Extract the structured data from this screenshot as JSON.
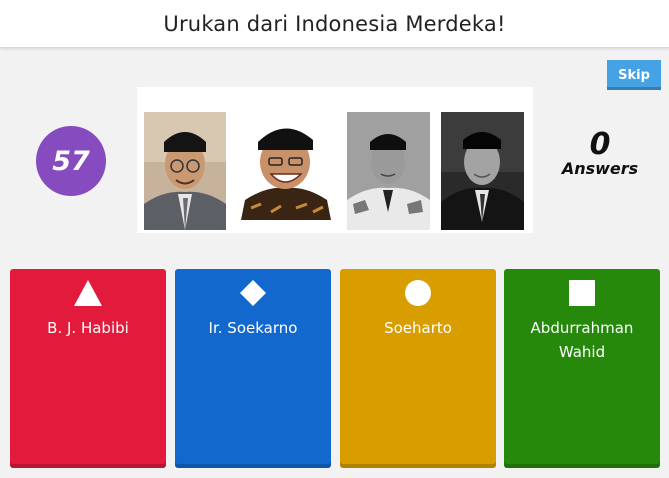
{
  "header": {
    "title": "Urukan dari Indonesia Merdeka!"
  },
  "controls": {
    "skip_label": "Skip"
  },
  "timer": {
    "value": "57"
  },
  "answer_counter": {
    "count": "0",
    "label": "Answers"
  },
  "colors": {
    "timer": "#864cbf",
    "skip": "#45a3e5",
    "red": "#e21b3c",
    "blue": "#1368ce",
    "yellow": "#d89e00",
    "green": "#26890c"
  },
  "answers": [
    {
      "shape": "triangle-icon",
      "color": "#e21b3c",
      "label": "B. J. Habibi"
    },
    {
      "shape": "diamond-icon",
      "color": "#1368ce",
      "label": "Ir. Soekarno"
    },
    {
      "shape": "circle-icon",
      "color": "#d89e00",
      "label": "Soeharto"
    },
    {
      "shape": "square-icon",
      "color": "#26890c",
      "label": "Abdurrahman Wahid"
    }
  ]
}
